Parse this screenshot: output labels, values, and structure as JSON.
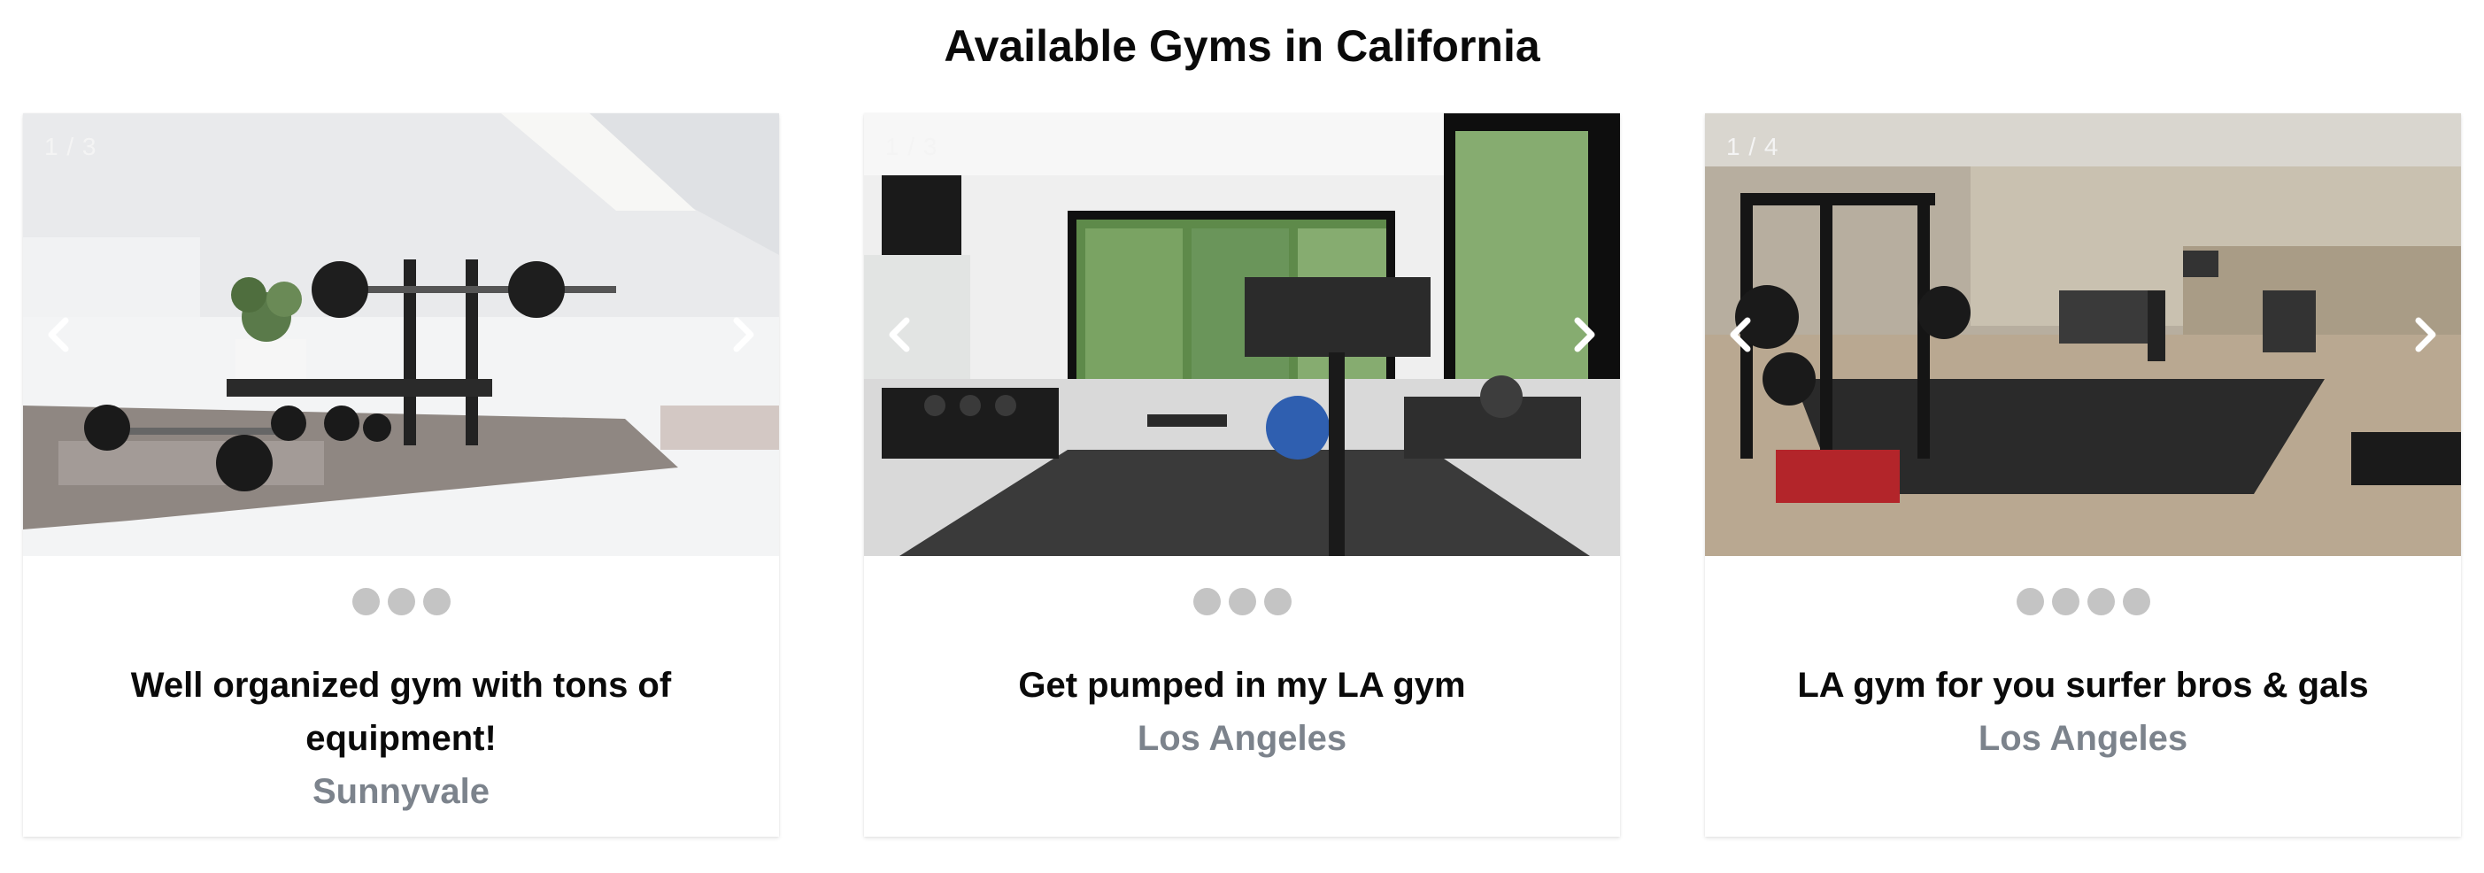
{
  "page": {
    "title": "Available Gyms in California"
  },
  "colors": {
    "title_text": "#0a0a0a",
    "location_text": "#7c838c",
    "dot_inactive": "#c4c4c4",
    "counter_text": "#f4f4f4"
  },
  "icons": {
    "prev": "chevron-left-icon",
    "next": "chevron-right-icon"
  },
  "listings": [
    {
      "counter": "1 / 3",
      "image_count": 3,
      "title": "Well organized gym with tons of equipment!",
      "location": "Sunnyvale"
    },
    {
      "counter": "1 / 3",
      "image_count": 3,
      "title": "Get pumped in my LA gym",
      "location": "Los Angeles"
    },
    {
      "counter": "1 / 4",
      "image_count": 4,
      "title": "LA gym for you surfer bros & gals",
      "location": "Los Angeles"
    }
  ]
}
